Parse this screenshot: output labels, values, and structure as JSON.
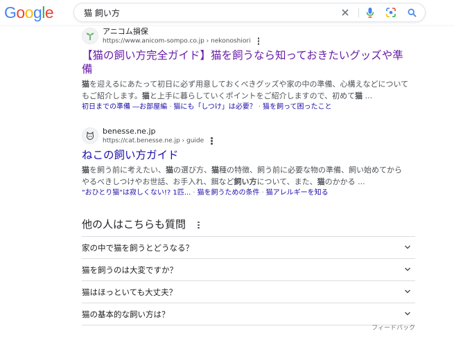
{
  "header": {
    "logo_text": "Google",
    "search_query": "猫 飼い方"
  },
  "colors": {
    "visited_link": "#681da8",
    "link": "#1a0dab",
    "logo": [
      "#4285F4",
      "#EA4335",
      "#FBBC05",
      "#4285F4",
      "#34A853",
      "#EA4335"
    ]
  },
  "results": [
    {
      "site_name": "アニコム損保",
      "url": "https://www.anicom-sompo.co.jp › nekonoshiori",
      "title_line1": "【猫の飼い方完全ガイド】猫を飼うなら知っておきたいグッズや準",
      "title_line2": "備",
      "snippet_line1_b": "猫",
      "snippet_line1": "を迎えるにあたって初日に必ず用意しておくべきグッズや家の中の準備、心構えなどについて",
      "snippet_line2_a": "もご紹介します。",
      "snippet_line2_b": "猫",
      "snippet_line2_c": "と上手に暮らしていくポイントをご紹介しますので、初めて",
      "snippet_line2_d": "猫",
      "snippet_line2_e": " ...",
      "sitelinks": [
        "初日までの準備 ―お部屋編",
        "猫にも「しつけ」は必要？",
        "猫を飼って困ったこと"
      ]
    },
    {
      "site_name": "benesse.ne.jp",
      "url": "https://cat.benesse.ne.jp › guide",
      "title": "ねこの飼い方ガイド",
      "snippet_line1_a": "猫",
      "snippet_line1_b": "を飼う前に考えたい、",
      "snippet_line1_c": "猫",
      "snippet_line1_d": "の選び方、",
      "snippet_line1_e": "猫",
      "snippet_line1_f": "種の特徴、飼う前に必要な物の準備、飼い始めてから",
      "snippet_line2_a": "やるべきしつけやお世話、お手入れ、餌など",
      "snippet_line2_b": "飼い方",
      "snippet_line2_c": "について、また、",
      "snippet_line2_d": "猫",
      "snippet_line2_e": "のかかる ...",
      "sitelinks": [
        "\"おひとり猫\"は寂しくない!? 1匹...",
        "猫を飼うための条件",
        "猫アレルギーを知る"
      ]
    }
  ],
  "paa": {
    "title": "他の人はこちらも質問",
    "questions": [
      "家の中で猫を飼うとどうなる？",
      "猫を飼うのは大変ですか？",
      "猫はほっといても大丈夫？",
      "猫の基本的な飼い方は？"
    ]
  },
  "feedback_label": "フィードバック"
}
